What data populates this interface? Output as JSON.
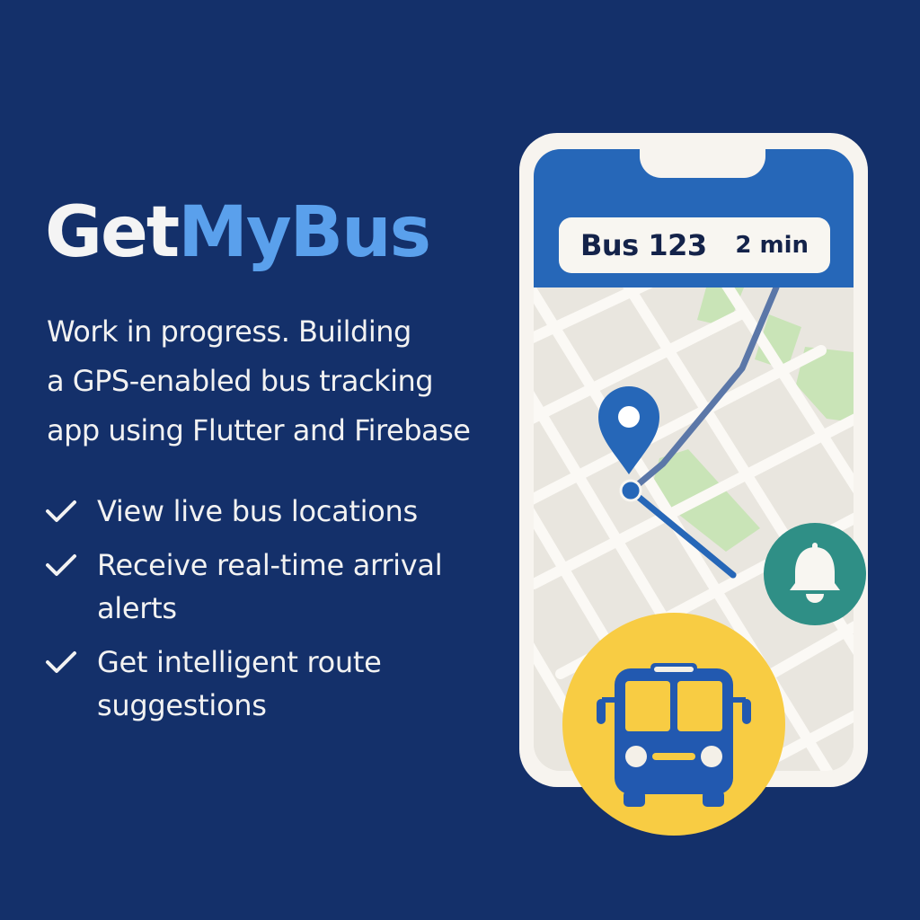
{
  "brand": {
    "part1": "Get",
    "part2": "MyBus"
  },
  "tagline": {
    "line1": "Work in progress. Building",
    "line2": "a GPS-enabled bus tracking",
    "line3": "app using Flutter and Firebase"
  },
  "features": [
    {
      "icon": "check-icon",
      "label": "View live bus locations"
    },
    {
      "icon": "check-icon",
      "label": "Receive real-time arrival alerts"
    },
    {
      "icon": "check-icon",
      "label": "Get intelligent route suggestions"
    }
  ],
  "phone": {
    "card": {
      "bus_label": "Bus 123",
      "eta_label": "2 min"
    },
    "icons": {
      "pin": "location-pin-icon",
      "bell": "bell-icon",
      "bus": "bus-icon"
    }
  },
  "colors": {
    "background": "#14306a",
    "accent_blue": "#5aa0ec",
    "header_blue": "#2667b8",
    "route": "#5b77a8",
    "bell_green": "#2f8f86",
    "bus_yellow": "#f8cc43",
    "park_green": "#c9e4b7"
  }
}
